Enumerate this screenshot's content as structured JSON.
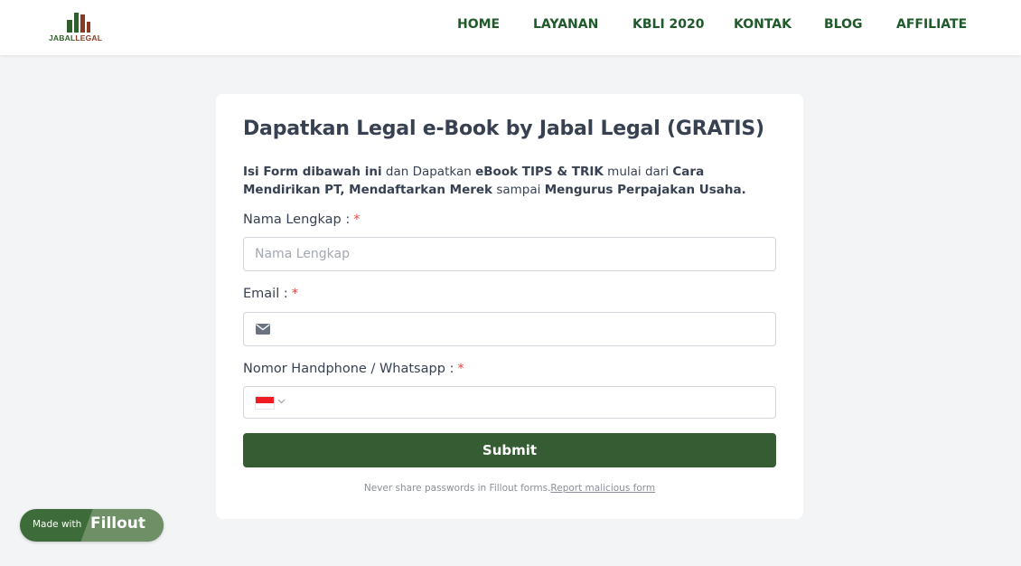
{
  "header": {
    "logo": {
      "word1": "JABAL",
      "word2": "LEGAL"
    },
    "nav": [
      {
        "label": "HOME"
      },
      {
        "label": "LAYANAN"
      },
      {
        "label": "KBLI 2020"
      },
      {
        "label": "KONTAK"
      },
      {
        "label": "BLOG"
      },
      {
        "label": "AFFILIATE"
      }
    ]
  },
  "form": {
    "title": "Dapatkan Legal e-Book by Jabal Legal (GRATIS)",
    "description": {
      "p1": "Isi Form dibawah ini",
      "p2": " dan Dapatkan ",
      "p3": "eBook TIPS & TRIK",
      "p4": " mulai dari ",
      "p5": "Cara Mendirikan PT, Mendaftarkan Merek",
      "p6": " sampai ",
      "p7": "Mengurus Perpajakan Usaha."
    },
    "fields": {
      "name": {
        "label": "Nama Lengkap :",
        "placeholder": "Nama Lengkap",
        "value": "",
        "required_mark": "*"
      },
      "email": {
        "label": "Email :",
        "placeholder": "",
        "value": "",
        "required_mark": "*",
        "icon": "mail-icon"
      },
      "phone": {
        "label": "Nomor Handphone / Whatsapp :",
        "placeholder": "",
        "value": "",
        "required_mark": "*",
        "country_flag": "indonesia-flag-icon"
      }
    },
    "submit_label": "Submit",
    "footer_text": "Never share passwords in Fillout forms.",
    "report_link": "Report malicious form"
  },
  "badge": {
    "made_with": "Made with",
    "brand": "Fillout"
  },
  "colors": {
    "nav_text": "#1f5a2a",
    "submit_bg": "#365c34",
    "required": "#ef4444",
    "page_bg": "#f3f4f6"
  }
}
